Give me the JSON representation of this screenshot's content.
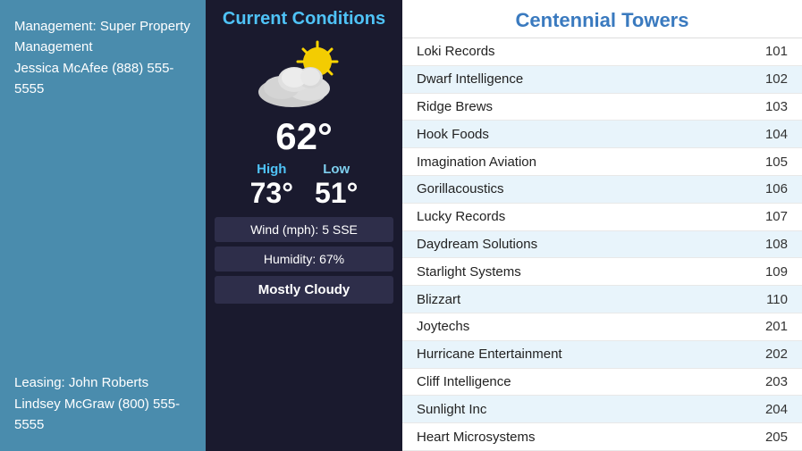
{
  "left": {
    "management_label": "Management: Super Property Management",
    "management_contact": "Jessica McAfee (888) 555-5555",
    "leasing_label": "Leasing: John Roberts",
    "leasing_contact": "Lindsey McGraw (800) 555-5555"
  },
  "middle": {
    "title": "Current Conditions",
    "temperature": "62°",
    "high_label": "High",
    "low_label": "Low",
    "high_value": "73°",
    "low_value": "51°",
    "wind": "Wind (mph): 5 SSE",
    "humidity": "Humidity: 67%",
    "condition": "Mostly Cloudy"
  },
  "right": {
    "title": "Centennial Towers",
    "tenants": [
      {
        "name": "Loki Records",
        "suite": "101"
      },
      {
        "name": "Dwarf Intelligence",
        "suite": "102"
      },
      {
        "name": "Ridge Brews",
        "suite": "103"
      },
      {
        "name": "Hook Foods",
        "suite": "104"
      },
      {
        "name": "Imagination Aviation",
        "suite": "105"
      },
      {
        "name": "Gorillacoustics",
        "suite": "106"
      },
      {
        "name": "Lucky Records",
        "suite": "107"
      },
      {
        "name": "Daydream Solutions",
        "suite": "108"
      },
      {
        "name": "Starlight Systems",
        "suite": "109"
      },
      {
        "name": "Blizzart",
        "suite": "110"
      },
      {
        "name": "Joytechs",
        "suite": "201"
      },
      {
        "name": "Hurricane Entertainment",
        "suite": "202"
      },
      {
        "name": "Cliff Intelligence",
        "suite": "203"
      },
      {
        "name": "Sunlight Inc",
        "suite": "204"
      },
      {
        "name": "Heart Microsystems",
        "suite": "205"
      }
    ]
  }
}
